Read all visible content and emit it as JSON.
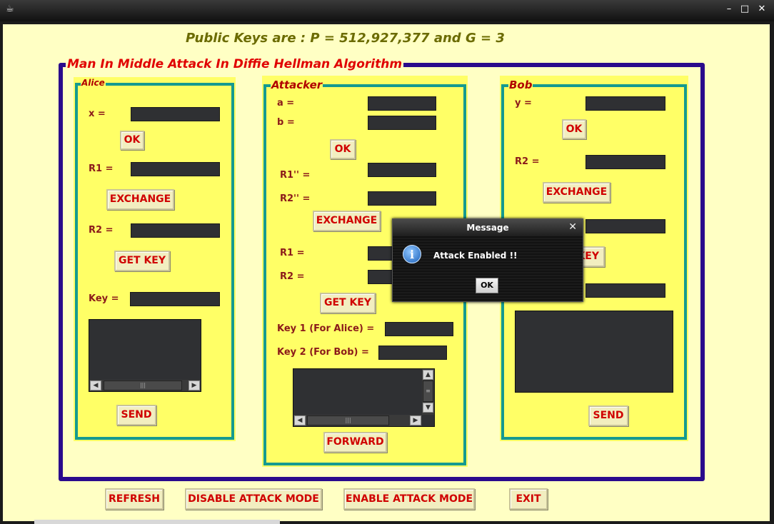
{
  "window": {
    "title_icon": "coffee-cup-icon",
    "controls": [
      "–",
      "□",
      "✕"
    ]
  },
  "public_keys": "Public Keys are :  P = 512,927,377  and G = 3",
  "main_title": "Man In Middle Attack In Diffie Hellman Algorithm",
  "alice": {
    "title": "Alice",
    "x_label": "x =",
    "ok": "OK",
    "r1_label": "R1 =",
    "exchange": "EXCHANGE",
    "r2_label": "R2 =",
    "get_key": "GET KEY",
    "key_label": "Key =",
    "send": "SEND"
  },
  "attacker": {
    "title": "Attacker",
    "a_label": "a =",
    "b_label": "b =",
    "ok": "OK",
    "r1pp_label": "R1'' =",
    "r2pp_label": "R2'' =",
    "exchange": "EXCHANGE",
    "r1_label": "R1 =",
    "r2_label": "R2 =",
    "get_key": "GET KEY",
    "key1_label": "Key 1 (For Alice) =",
    "key2_label": "Key 2 (For Bob) =",
    "forward": "FORWARD"
  },
  "bob": {
    "title": "Bob",
    "y_label": "y =",
    "ok": "OK",
    "r2_label": "R2 =",
    "exchange": "EXCHANGE",
    "get_key_partial": "KEY",
    "send": "SEND"
  },
  "bottom_buttons": {
    "refresh": "REFRESH",
    "disable": "DISABLE ATTACK MODE",
    "enable": "ENABLE ATTACK MODE",
    "exit": "EXIT"
  },
  "dialog": {
    "title": "Message",
    "close": "✕",
    "icon": "info-icon",
    "message": "Attack Enabled !!",
    "ok": "OK"
  }
}
